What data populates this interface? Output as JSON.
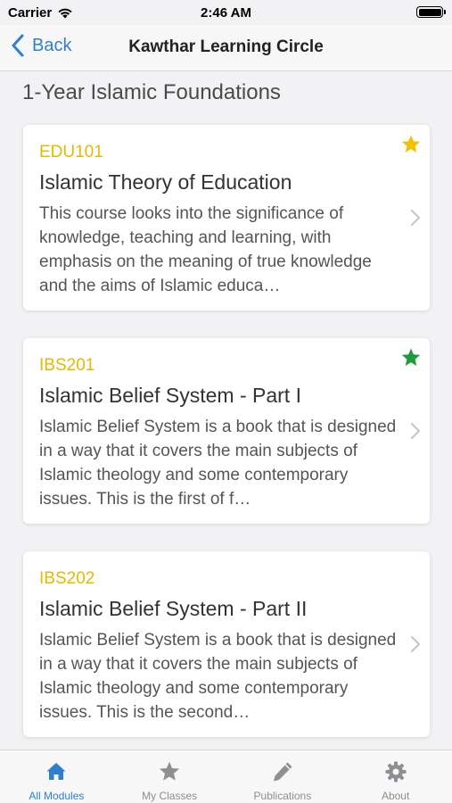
{
  "status_bar": {
    "carrier": "Carrier",
    "time": "2:46 AM"
  },
  "nav": {
    "back_label": "Back",
    "title": "Kawthar Learning Circle"
  },
  "section_title": "1-Year Islamic Foundations",
  "courses": [
    {
      "code": "EDU101",
      "title": "Islamic Theory of Education",
      "description": "This course looks into the significance of knowledge, teaching and learning, with emphasis on the meaning of true knowledge and the aims of Islamic educa…",
      "star_icon": "star-icon",
      "star_color": "#f2c200"
    },
    {
      "code": "IBS201",
      "title": "Islamic Belief System - Part I",
      "description": "Islamic Belief System is a book that is designed in a way that it covers the main subjects of Islamic theology and some contemporary issues. This is the first of f…",
      "star_icon": "star-icon",
      "star_color": "#1e9a3a"
    },
    {
      "code": "IBS202",
      "title": "Islamic Belief System - Part II",
      "description": "Islamic Belief System is a book that is designed in a way that it covers the main subjects of Islamic theology and some contemporary issues. This is the second…",
      "star_icon": null,
      "star_color": null
    }
  ],
  "tabs": [
    {
      "label": "All Modules",
      "icon": "home-icon",
      "active": true
    },
    {
      "label": "My Classes",
      "icon": "star-icon",
      "active": false
    },
    {
      "label": "Publications",
      "icon": "pencil-icon",
      "active": false
    },
    {
      "label": "About",
      "icon": "gear-icon",
      "active": false
    }
  ],
  "colors": {
    "accent": "#2f7fd0",
    "code": "#e6b800",
    "tab_inactive": "#8e8e93"
  }
}
